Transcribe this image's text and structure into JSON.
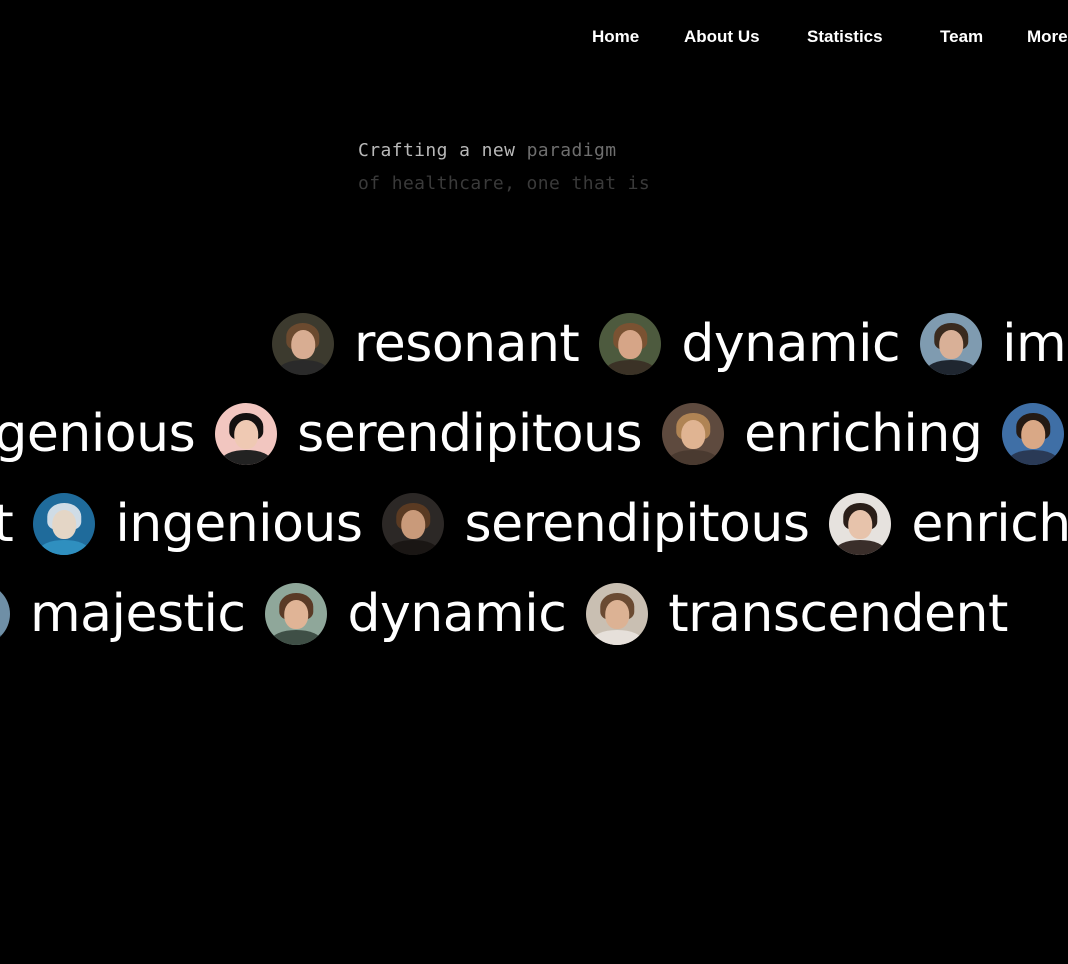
{
  "nav": {
    "items": [
      {
        "label": "Home",
        "name": "nav-home"
      },
      {
        "label": "About Us",
        "name": "nav-about-us"
      },
      {
        "label": "Statistics",
        "name": "nav-statistics"
      },
      {
        "label": "Team",
        "name": "nav-team"
      },
      {
        "label": "More",
        "name": "nav-more"
      }
    ]
  },
  "tagline": {
    "line1_strong": "Crafting a new",
    "line1_fade": " paradigm",
    "line2": "of healthcare, one that is"
  },
  "marquee": {
    "rows": [
      {
        "items": [
          {
            "type": "avatar",
            "icon": "avatar-portrait-icon",
            "bg": "#3c3a2e",
            "skin": "#d8ad92",
            "hair": "#6b4a2f",
            "cloth": "#2a2a2a"
          },
          {
            "type": "word",
            "text": "resonant"
          },
          {
            "type": "avatar",
            "icon": "avatar-portrait-icon",
            "bg": "#4d5a3e",
            "skin": "#d6a587",
            "hair": "#7a5232",
            "cloth": "#3b3226"
          },
          {
            "type": "word",
            "text": "dynamic"
          },
          {
            "type": "avatar",
            "icon": "avatar-portrait-icon",
            "bg": "#7f9bb0",
            "skin": "#d9b097",
            "hair": "#3a2a1e",
            "cloth": "#1f2630"
          },
          {
            "type": "word",
            "text": "impactful"
          },
          {
            "type": "avatar",
            "icon": "avatar-portrait-icon",
            "bg": "#e6e4e0",
            "skin": "#d6ab8f",
            "hair": "#1e1a18",
            "cloth": "#3a3a3a"
          }
        ]
      },
      {
        "items": [
          {
            "type": "word",
            "text": "ingenious"
          },
          {
            "type": "avatar",
            "icon": "avatar-portrait-icon",
            "bg": "#f2c6c0",
            "skin": "#efc9b3",
            "hair": "#141010",
            "cloth": "#222222"
          },
          {
            "type": "word",
            "text": "serendipitous"
          },
          {
            "type": "avatar",
            "icon": "avatar-portrait-icon",
            "bg": "#5e4a3e",
            "skin": "#e0b492",
            "hair": "#b08454",
            "cloth": "#4a3a30"
          },
          {
            "type": "word",
            "text": "enriching"
          },
          {
            "type": "avatar",
            "icon": "avatar-portrait-icon",
            "bg": "#3f6fa6",
            "skin": "#d9a886",
            "hair": "#241a14",
            "cloth": "#2a3a56"
          }
        ]
      },
      {
        "items": [
          {
            "type": "word",
            "text": "resonant"
          },
          {
            "type": "avatar",
            "icon": "avatar-portrait-icon",
            "bg": "#1f6b9b",
            "skin": "#e4d6c6",
            "hair": "#cfdce6",
            "cloth": "#2f8fbf"
          },
          {
            "type": "word",
            "text": "ingenious"
          },
          {
            "type": "avatar",
            "icon": "avatar-portrait-icon",
            "bg": "#2c2826",
            "skin": "#c99a7a",
            "hair": "#5a3a22",
            "cloth": "#1a1614"
          },
          {
            "type": "word",
            "text": "serendipitous"
          },
          {
            "type": "avatar",
            "icon": "avatar-portrait-icon",
            "bg": "#e6e2de",
            "skin": "#e7c3ab",
            "hair": "#2a1e18",
            "cloth": "#3a2e2a"
          },
          {
            "type": "word",
            "text": "enriching"
          }
        ]
      },
      {
        "items": [
          {
            "type": "avatar",
            "icon": "avatar-portrait-icon",
            "bg": "#6f8fa6",
            "skin": "#d2a88c",
            "hair": "#3a2a22",
            "cloth": "#4f6f86"
          },
          {
            "type": "word",
            "text": "majestic"
          },
          {
            "type": "avatar",
            "icon": "avatar-portrait-icon",
            "bg": "#8fa79a",
            "skin": "#e0b496",
            "hair": "#5a3a26",
            "cloth": "#3f4f46"
          },
          {
            "type": "word",
            "text": "dynamic"
          },
          {
            "type": "avatar",
            "icon": "avatar-portrait-icon",
            "bg": "#c9bfb2",
            "skin": "#dcb294",
            "hair": "#6a4a32",
            "cloth": "#e6e0da"
          },
          {
            "type": "word",
            "text": "transcendent"
          }
        ]
      }
    ]
  }
}
